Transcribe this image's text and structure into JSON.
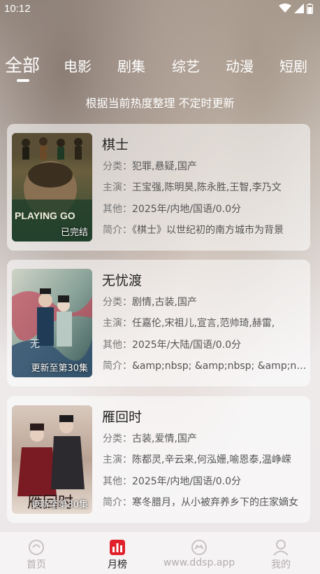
{
  "status_bar": {
    "time": "10:12",
    "icons": [
      "wifi-icon",
      "signal-icon",
      "battery-icon"
    ]
  },
  "tabs": [
    {
      "label": "全部",
      "active": true
    },
    {
      "label": "电影",
      "active": false
    },
    {
      "label": "剧集",
      "active": false
    },
    {
      "label": "综艺",
      "active": false
    },
    {
      "label": "动漫",
      "active": false
    },
    {
      "label": "短剧",
      "active": false
    }
  ],
  "subtitle": "根据当前热度整理 不定时更新",
  "cards": [
    {
      "title": "棋士",
      "badge": "已完结",
      "category_label": "分类：",
      "category": "犯罪,悬疑,国产",
      "cast_label": "主演：",
      "cast": "王宝强,陈明昊,陈永胜,王智,李乃文",
      "other_label": "其他：",
      "other": "2025年/内地/国语/0.0分",
      "intro_label": "简介：",
      "intro": "《棋士》以世纪初的南方城市为背景",
      "poster_text": "PLAYING GO"
    },
    {
      "title": "无忧渡",
      "badge": "更新至第30集",
      "category_label": "分类：",
      "category": "剧情,古装,国产",
      "cast_label": "主演：",
      "cast": "任嘉伦,宋祖儿,宣言,范帅琦,赫雷,",
      "other_label": "其他：",
      "other": "2025年/大陆/国语/0.0分",
      "intro_label": "简介：",
      "intro": "&amp;nbsp; &amp;nbsp; &amp;nbsp; &amp;nbsp;",
      "poster_text": ""
    },
    {
      "title": "雁回时",
      "badge": "更新至第30集",
      "category_label": "分类：",
      "category": "古装,爱情,国产",
      "cast_label": "主演：",
      "cast": "陈都灵,辛云来,何泓姗,喻恩泰,温峥嵘",
      "other_label": "其他：",
      "other": "2025年/内地/国语/0.0分",
      "intro_label": "简介：",
      "intro": "寒冬腊月，从小被弃养乡下的庄家嫡女",
      "poster_text": ""
    }
  ],
  "bottom_nav": [
    {
      "label": "首页",
      "icon": "home-icon",
      "active": false
    },
    {
      "label": "月榜",
      "icon": "chart-icon",
      "active": true
    },
    {
      "label": "www.ddsp.app",
      "icon": "discover-icon",
      "active": false
    },
    {
      "label": "我的",
      "icon": "profile-icon",
      "active": false
    }
  ]
}
